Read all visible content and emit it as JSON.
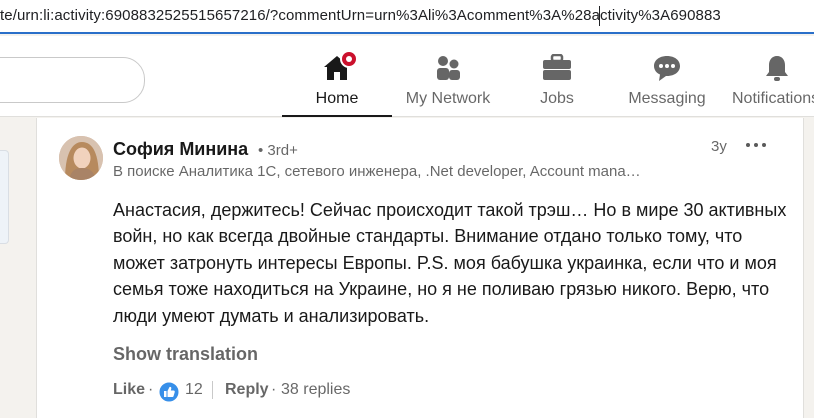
{
  "browser": {
    "url": "te/urn:li:activity:6908832525515657216/?commentUrn=urn%3Ali%3Acomment%3A%28activity%3A690883"
  },
  "nav": {
    "items": [
      {
        "label": "Home",
        "icon": "home-icon",
        "active": true
      },
      {
        "label": "My Network",
        "icon": "network-icon"
      },
      {
        "label": "Jobs",
        "icon": "briefcase-icon"
      },
      {
        "label": "Messaging",
        "icon": "chat-bubble-icon"
      },
      {
        "label": "Notifications",
        "icon": "bell-icon"
      }
    ]
  },
  "comment": {
    "author": "София Минина",
    "degree": "• 3rd+",
    "headline": "В поиске Аналитика 1С, сетевого инженера, .Net developer, Account mana…",
    "time": "3y",
    "text": "Анастасия, держитесь! Сейчас происходит такой трэш… Но в мире 30 активных войн, но как всегда двойные стандарты. Внимание отдано только тому, что может затронуть интересы Европы. P.S. моя бабушка украинка, если что и моя семья тоже находиться на Украине, но я не поливаю грязью никого. Верю, что люди умеют думать и анализировать.",
    "show_translation": "Show translation",
    "like_label": "Like",
    "separator": "·",
    "like_count": "12",
    "reply_label": "Reply",
    "replies": "38 replies"
  },
  "colors": {
    "accent_blue": "#0a66c2",
    "notification_red": "#cb112d",
    "url_underline": "#2a6fc9"
  }
}
